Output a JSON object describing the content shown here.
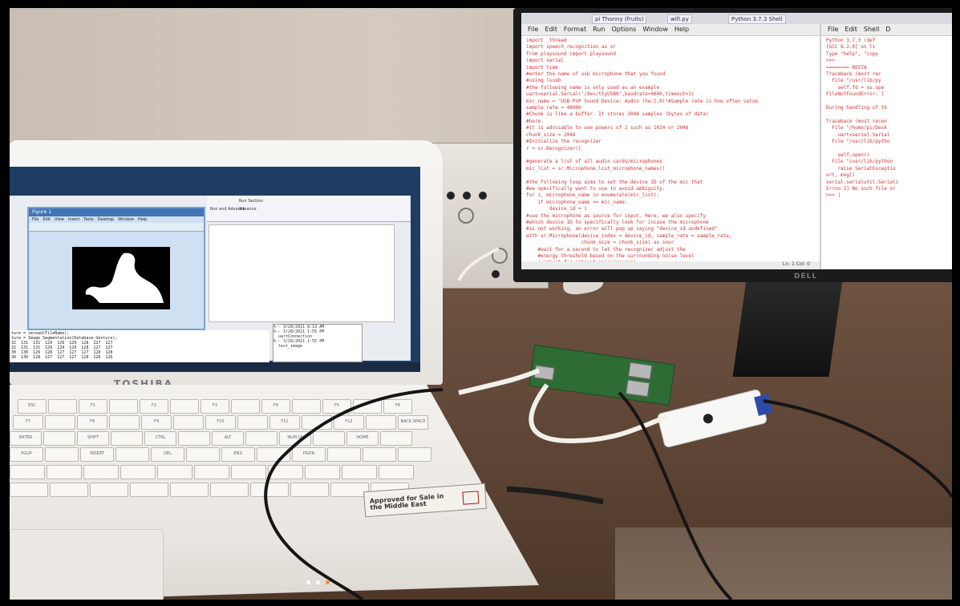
{
  "monitor": {
    "taskbar_tabs": [
      "pi Thonny (fruits)",
      "wifi.py",
      "Python 3.7.3 Shell"
    ],
    "brand": "DELL",
    "editor": {
      "menu": [
        "File",
        "Edit",
        "Format",
        "Run",
        "Options",
        "Window",
        "Help"
      ],
      "code_lines": [
        "import _thread",
        "import speech_recognition as sr",
        "from playsound import playsound",
        "import serial",
        "import time",
        "#enter the name of usb microphone that you found",
        "#using lsusb",
        "#the following name is only used as an example",
        "uart=serial.Serial('/dev/ttyUSB0',baudrate=9600,timeout=1)",
        "mic_name = \"USB PnP Sound Device: Audio (hw:1,0)\"#Sample rate is how often value",
        "sample_rate = 48000",
        "#Chunk is like a buffer. It stores 2048 samples (bytes of data)",
        "#here.",
        "#it is advisable to use powers of 2 such as 1024 or 2048",
        "chunk_size = 2048",
        "#Initialize the recognizer",
        "r = sr.Recognizer()",
        "",
        "#generate a list of all audio cards/microphones",
        "mic_list = sr.Microphone.list_microphone_names()",
        "",
        "#the following loop aims to set the device ID of the mic that",
        "#we specifically want to use to avoid ambiguity.",
        "for i, microphone_name in enumerate(mic_list):",
        "    if microphone_name == mic_name:",
        "        device_id = i",
        "#use the microphone as source for input. Here, we also specify",
        "#which device ID to specifically look for incase the microphone",
        "#is not working, an error will pop up saying \"device_id undefined\"",
        "with sr.Microphone(device_index = device_id, sample_rate = sample_rate,",
        "                   chunk_size = chunk_size) as sour",
        "    #wait for a second to let the recognizer adjust the",
        "    #energy threshold based on the surrounding noise level",
        "    r.adjust_for_ambient_noise(source)",
        "    print(\"Say Something\")",
        "    #listens for the user's input",
        "    audio = r.listen(source)",
        "    try:",
        "",
        "        text = r.recognize_google(audio)"
      ],
      "status": "Ln: 1  Col: 0"
    },
    "shell": {
      "menu": [
        "File",
        "Edit",
        "Shell",
        "D"
      ],
      "lines": [
        "Python 3.7.3 (def",
        "[GCC 8.2.0] on li",
        "Type \"help\", \"copy",
        ">>>",
        "======== RESTA",
        "Traceback (most rec",
        "  File \"/usr/lib/py",
        "    self.fd = os.ope",
        "FileNotFoundError: [",
        "",
        "During handling of th",
        "",
        "Traceback (most recen",
        "  File \"/home/pi/Desk",
        "    uart=serial.Serial",
        "  File \"/usr/lib/pytho",
        "",
        "    self.open()",
        "  File \"/usr/lib/python",
        "    raise SerialExceptio",
        "ort, msg))",
        "serial.serialutil.Seriali",
        "Errno 2] No such file or",
        ">>> |"
      ]
    }
  },
  "laptop": {
    "brand": "TOSHIBA",
    "figure": {
      "title": "Figure 1",
      "menu": [
        "File",
        "Edit",
        "View",
        "Insert",
        "Tools",
        "Desktop",
        "Window",
        "Help"
      ]
    },
    "matlab_toolbar": [
      "Run Section",
      "Advance",
      "Run and Advance"
    ],
    "command_lines": [
      "ture = imread(FileName);",
      "ture = Image_Segmentation(Database_Gesture);",
      "32  131  131  129  129  129  128  127  127",
      "32  131  131  129  129  129  128  127  127",
      "30  130  129  128  127  127  127  128  128",
      "30  130  128  127  127  127  128  126  126",
      "",
      "ecognized gesture is = ones!"
    ],
    "workspace_lines": [
      "%-- 3/28/2021 8:13 AM",
      "%-- 3/28/2021 1:55 PM",
      "  uartConnection",
      "%-- 3/28/2021 1:55 PM",
      "  test_image"
    ],
    "sticker_text": "Approved for Sale in the Middle East",
    "keys": [
      "ESC",
      "F1",
      "F2",
      "F3",
      "F4",
      "F5",
      "F6",
      "F7",
      "F8",
      "F9",
      "F10",
      "F11",
      "F12",
      "BACK SPACE",
      "ENTER",
      "SHIFT",
      "CTRL",
      "ALT",
      "NUM LK",
      "HOME",
      "PGUP",
      "INSERT",
      "DEL",
      "END",
      "PGDN"
    ]
  },
  "colors": {
    "code_red": "#cc3333",
    "pi_green": "#2e6b35",
    "usb_blue": "#2e4aa8",
    "led_white": "#ffffff",
    "led_orange": "#ff8a2a"
  }
}
